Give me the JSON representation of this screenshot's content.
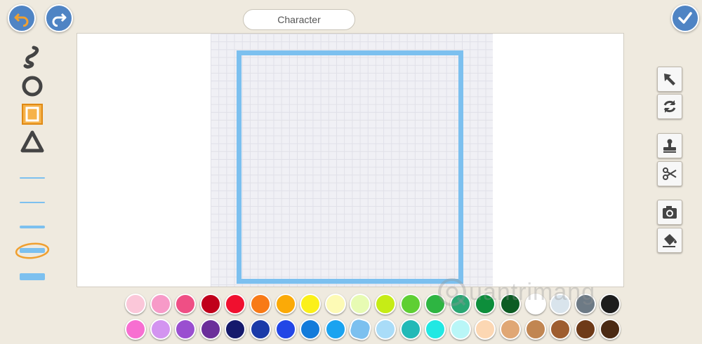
{
  "title": "Character",
  "colors": {
    "blue_button": "#4f84c4",
    "accent_blue": "#7cc0ef",
    "accent_orange": "#f0a030",
    "background": "#efeadf"
  },
  "toolbar_top": {
    "undo": "undo-arrow-icon",
    "redo": "redo-arrow-icon",
    "done": "checkmark-icon"
  },
  "left_tools": [
    "brush-icon",
    "circle-icon",
    "rectangle-icon",
    "triangle-icon"
  ],
  "line_widths": [
    "thin",
    "thin",
    "medium",
    "thick-selected",
    "thickest"
  ],
  "right_tools": [
    "select-arrow-icon",
    "rotate-icon",
    "stamp-icon",
    "scissors-icon",
    "camera-icon",
    "paint-bucket-icon"
  ],
  "palette": {
    "row1": [
      "#fbc7d9",
      "#f79ac8",
      "#ef4f85",
      "#c0001b",
      "#f0102f",
      "#f87a16",
      "#fbaa07",
      "#fbf01a",
      "#fdfab5",
      "#e7fbb3",
      "#c6ec16",
      "#5fcf33",
      "#2eb542",
      "#2aa773",
      "#0d8e3b",
      "#0c5c24",
      "#ffffff",
      "#d9e4ec",
      "#6d7a85",
      "#1d1d1d"
    ],
    "row2": [
      "#f76fd1",
      "#d394f0",
      "#9a4fd0",
      "#6b2e9a",
      "#151a6c",
      "#1a3aa8",
      "#2246e6",
      "#137bda",
      "#1aa3f0",
      "#7cc0ef",
      "#a9dcf8",
      "#22b9b7",
      "#21e8e3",
      "#b9f6f7",
      "#fcd7b3",
      "#e0a775",
      "#c18652",
      "#9e5d30",
      "#6e3a18",
      "#4b2a14"
    ],
    "selected": "#7cc0ef"
  },
  "watermark": {
    "text": "uantrimang",
    "logo": "quantrimang-logo-icon"
  }
}
